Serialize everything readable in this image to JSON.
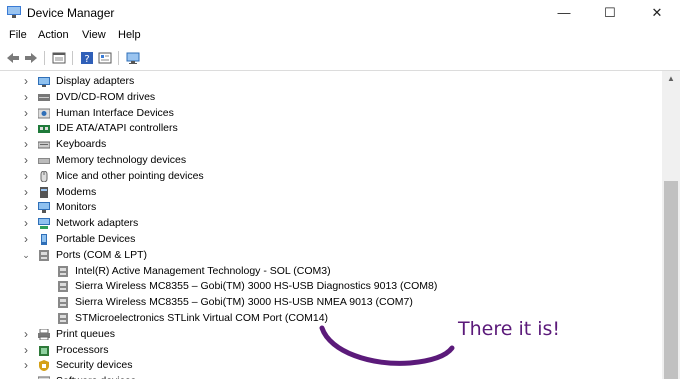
{
  "window": {
    "title": "Device Manager",
    "minimize": "—",
    "maximize": "☐",
    "close": "✕"
  },
  "menu": [
    "File",
    "Action",
    "View",
    "Help"
  ],
  "toolbar": {
    "icons": [
      "back-icon",
      "forward-icon",
      "properties-icon",
      "help-icon",
      "details-icon",
      "monitor-icon"
    ]
  },
  "tree": {
    "items": [
      {
        "label": "Display adapters",
        "icon": "display-adapter-icon"
      },
      {
        "label": "DVD/CD-ROM drives",
        "icon": "dvd-drive-icon"
      },
      {
        "label": "Human Interface Devices",
        "icon": "hid-icon"
      },
      {
        "label": "IDE ATA/ATAPI controllers",
        "icon": "ide-controller-icon"
      },
      {
        "label": "Keyboards",
        "icon": "keyboard-icon"
      },
      {
        "label": "Memory technology devices",
        "icon": "memory-device-icon"
      },
      {
        "label": "Mice and other pointing devices",
        "icon": "mouse-icon"
      },
      {
        "label": "Modems",
        "icon": "modem-icon"
      },
      {
        "label": "Monitors",
        "icon": "monitor-icon"
      },
      {
        "label": "Network adapters",
        "icon": "network-adapter-icon"
      },
      {
        "label": "Portable Devices",
        "icon": "portable-device-icon"
      },
      {
        "label": "Ports (COM & LPT)",
        "icon": "port-icon",
        "expanded": true
      },
      {
        "label": "Intel(R) Active Management Technology - SOL (COM3)",
        "icon": "port-icon",
        "child": true
      },
      {
        "label": "Sierra Wireless MC8355 – Gobi(TM) 3000 HS-USB Diagnostics 9013 (COM8)",
        "icon": "port-icon",
        "child": true
      },
      {
        "label": "Sierra Wireless MC8355 – Gobi(TM) 3000 HS-USB NMEA 9013 (COM7)",
        "icon": "port-icon",
        "child": true
      },
      {
        "label": "STMicroelectronics STLink Virtual COM Port (COM14)",
        "icon": "port-icon",
        "child": true
      },
      {
        "label": "Print queues",
        "icon": "printer-icon"
      },
      {
        "label": "Processors",
        "icon": "processor-icon"
      },
      {
        "label": "Security devices",
        "icon": "security-icon"
      },
      {
        "label": "Software devices",
        "icon": "software-device-icon"
      }
    ]
  },
  "annotation": {
    "text": "There it is!",
    "color": "#5b1a7a"
  },
  "colors": {
    "icon_blue": "#2f6fb8",
    "icon_gray": "#6a6a6a"
  }
}
